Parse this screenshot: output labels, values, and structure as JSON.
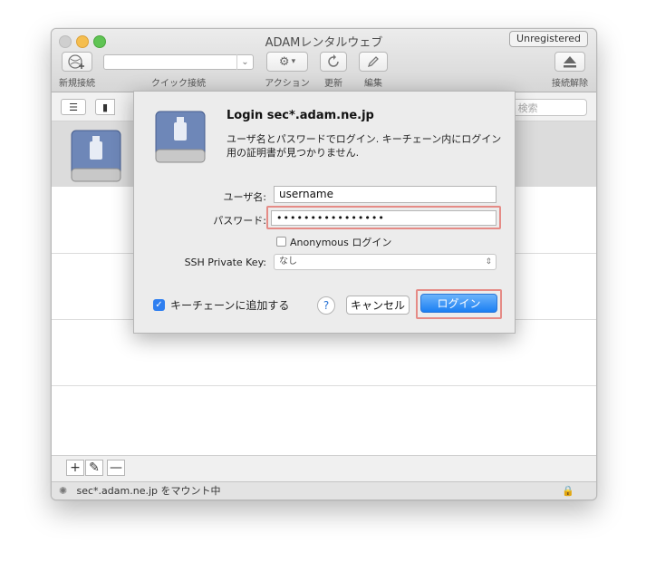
{
  "window": {
    "title": "ADAMレンタルウェブ",
    "unregistered": "Unregistered"
  },
  "toolbar": {
    "new_connection": "新規接続",
    "quick_connect": "クイック接続",
    "quick_connect_value": "",
    "action": "アクション",
    "refresh": "更新",
    "edit": "編集",
    "disconnect": "接続解除"
  },
  "search": {
    "placeholder": "検索"
  },
  "dialog": {
    "title": "Login sec*.adam.ne.jp",
    "message": "ユーザ名とパスワードでログイン. キーチェーン内にログイン用の証明書が見つかりません.",
    "username_label": "ユーザ名:",
    "username_value": "username",
    "password_label": "パスワード:",
    "password_value": "••••••••••••••••",
    "anonymous_label": "Anonymous ログイン",
    "anonymous_checked": false,
    "ssh_key_label": "SSH Private Key:",
    "ssh_key_value": "なし",
    "keychain_label": "キーチェーンに追加する",
    "keychain_checked": true,
    "help": "?",
    "cancel": "キャンセル",
    "login": "ログイン",
    "highlight_color": "#e58b86",
    "primary_color": "#1b7ff3"
  },
  "bottom": {
    "add": "+",
    "edit": "✎",
    "remove": "—"
  },
  "status": {
    "text": "sec*.adam.ne.jp をマウント中"
  }
}
